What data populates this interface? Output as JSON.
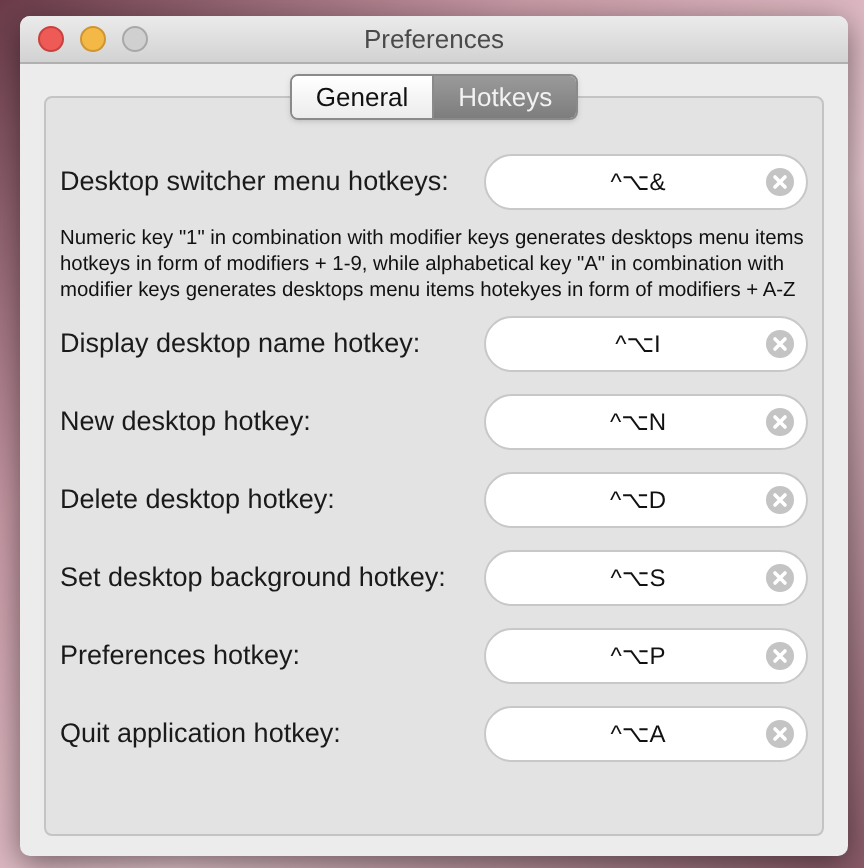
{
  "window": {
    "title": "Preferences",
    "buttons": [
      {
        "kind": "close",
        "disabled": false
      },
      {
        "kind": "minimize",
        "disabled": false
      },
      {
        "kind": "zoom",
        "disabled": true
      }
    ]
  },
  "tabs": [
    {
      "label": "General",
      "selected": false
    },
    {
      "label": "Hotkeys",
      "selected": true
    }
  ],
  "switcher": {
    "label": "Desktop switcher menu hotkeys:",
    "value": "^⌥&"
  },
  "note": "Numeric key \"1\" in combination with modifier keys generates desktops menu items hotkeys in form of modifiers + 1-9, while alphabetical key \"A\" in combination with modifier keys generates desktops menu items hotekyes in form of modifiers + A-Z",
  "hotkeys": [
    {
      "label": "Display desktop name hotkey:",
      "value": "^⌥I"
    },
    {
      "label": "New desktop hotkey:",
      "value": "^⌥N"
    },
    {
      "label": "Delete desktop hotkey:",
      "value": "^⌥D"
    },
    {
      "label": "Set desktop background hotkey:",
      "value": "^⌥S"
    },
    {
      "label": "Preferences hotkey:",
      "value": "^⌥P"
    },
    {
      "label": "Quit application hotkey:",
      "value": "^⌥A"
    }
  ]
}
